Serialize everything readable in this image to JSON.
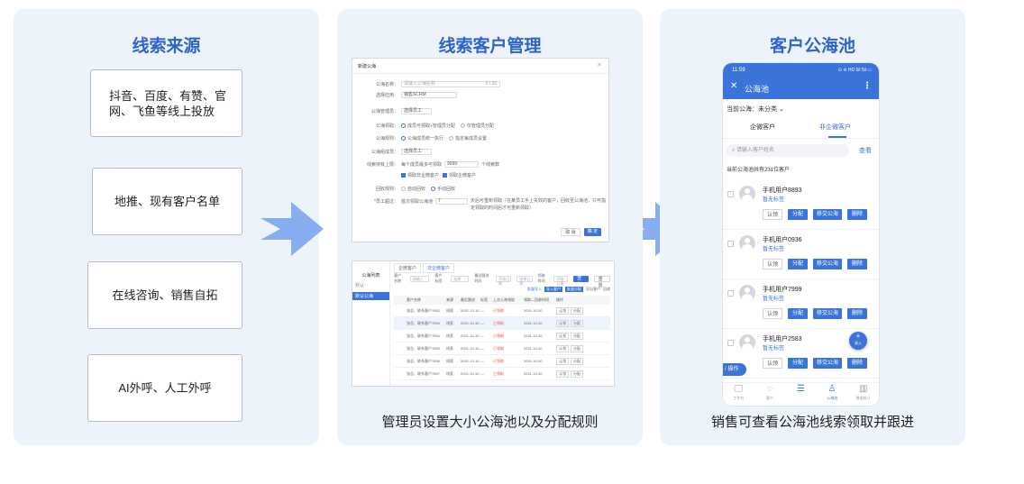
{
  "panel1": {
    "title": "线索来源",
    "sources": [
      "抖音、百度、有赞、官网、飞鱼等线上投放",
      "地推、现有客户名单",
      "在线咨询、销售自拓",
      "AI外呼、人工外呼"
    ]
  },
  "panel2": {
    "title": "线索客户管理",
    "caption": "管理员设置大小公海池以及分配规则",
    "dialog": {
      "title": "新建公海",
      "close": "×",
      "name_label": "公海名称：",
      "name_placeholder": "请输入公海名称",
      "name_count": "0 / 20",
      "app_label": "选择应用：",
      "app_value": "销售SCRM",
      "admin_label": "公海管理员：",
      "admin_value": "选择员工",
      "claim_label": "公海领取：",
      "claim_opt1": "成员可领取+管理员分配",
      "claim_opt2": "仅管理员分配",
      "rule_label": "公海规则：",
      "rule_opt1": "公海成员统一执行",
      "rule_opt2": "指定每成员设置",
      "member_label": "公海组成员：",
      "member_value": "选择员工",
      "limit_label": "线索持有上限：",
      "limit_text": "每个成员最多可领取",
      "limit_value": "9999",
      "limit_unit": "个线索数",
      "chk1": "领取非企微客户",
      "chk2": "领取企微客户",
      "recycle_label": "回收规则：",
      "recycle_opt1": "自动回收",
      "recycle_opt2": "手动回收",
      "staff_label": "*员工超过：",
      "staff_text": "首次领取公海池",
      "staff_value": "7",
      "staff_note": "天后可重新领取（在某员工手上失效的客户，回收至公海池，只可指定领取的时间后才可重新领取）",
      "cancel": "取 消",
      "ok": "确 定"
    },
    "table": {
      "sidebar_title": "公海列表",
      "sidebar_items": [
        "默认",
        "默认公海"
      ],
      "tabs": [
        "企微客户",
        "非企微客户"
      ],
      "filters": [
        "客户名称",
        "请输入",
        "客户标签",
        "选择",
        "最近跟进时间",
        "开始日期",
        "结束日期",
        "领取时间",
        "开始日期"
      ],
      "actions": [
        "批量导入",
        "导入客户",
        "批量分配",
        "导出客户",
        "回收"
      ],
      "search": "查 询",
      "reset": "重 置",
      "headers": [
        "客户名称",
        "来源",
        "最近跟进",
        "标签",
        "上次公海领取",
        "领取—回收时间",
        "操作"
      ],
      "rows": [
        [
          "张总、联系客户7852",
          "线索",
          "2021-10-10",
          "—",
          "已领取",
          "2021-10-20",
          "认领",
          "分配"
        ],
        [
          "张总、联系客户7853",
          "线索",
          "2021-10-10",
          "—",
          "已领取",
          "2021-10-20",
          "认领",
          "分配"
        ],
        [
          "张总、联系客户7854",
          "线索",
          "2021-10-10",
          "—",
          "已领取",
          "2021-10-20",
          "认领",
          "分配"
        ],
        [
          "张总、联系客户7855",
          "线索",
          "2021-10-10",
          "—",
          "已领取",
          "2021-10-20",
          "认领",
          "分配"
        ],
        [
          "张总、联系客户7856",
          "线索",
          "2021-10-10",
          "—",
          "已领取",
          "2021-10-20",
          "认领",
          "分配"
        ],
        [
          "张总、联系客户7857",
          "线索",
          "2021-10-10",
          "—",
          "已领取",
          "2021-10-20",
          "认领",
          "分配"
        ]
      ]
    }
  },
  "panel3": {
    "title": "客户公海池",
    "caption": "销售可查看公海池线索领取并跟进",
    "phone": {
      "time": "11:59",
      "status": "⊙ ❊ HD 5il 5il ▭",
      "close": "✕",
      "title": "公海池",
      "more": "⋮",
      "pool_label": "当前公海：未分类",
      "chevron": "⌄",
      "tab1": "企微客户",
      "tab2": "非企微客户",
      "search_placeholder": "请输入客户姓名",
      "search_btn": "查看",
      "count_text": "当前公海池共有231位客户",
      "customers": [
        {
          "name": "手机用户8893",
          "tag": "暂无标签"
        },
        {
          "name": "手机用户0936",
          "tag": "暂无标签"
        },
        {
          "name": "手机用户7999",
          "tag": "暂无标签"
        },
        {
          "name": "手机用户2583",
          "tag": "暂无标签"
        }
      ],
      "btn_claim": "认领",
      "btn_assign": "分配",
      "btn_move": "移交公海",
      "btn_delete": "删除",
      "batch": "/ 操作",
      "fab_plus": "+",
      "fab_label": "录入",
      "nav": [
        {
          "icon": "monitor-icon",
          "label": "工作台"
        },
        {
          "icon": "chat-icon",
          "label": "客户"
        },
        {
          "icon": "list-icon",
          "label": ""
        },
        {
          "icon": "users-icon",
          "label": "公海池"
        },
        {
          "icon": "chart-icon",
          "label": "数据统计"
        }
      ]
    }
  },
  "colors": {
    "accent": "#3a74d8",
    "panel_bg": "#edf3fb",
    "title": "#2f63c8",
    "arrow": "#7fa9ec"
  }
}
